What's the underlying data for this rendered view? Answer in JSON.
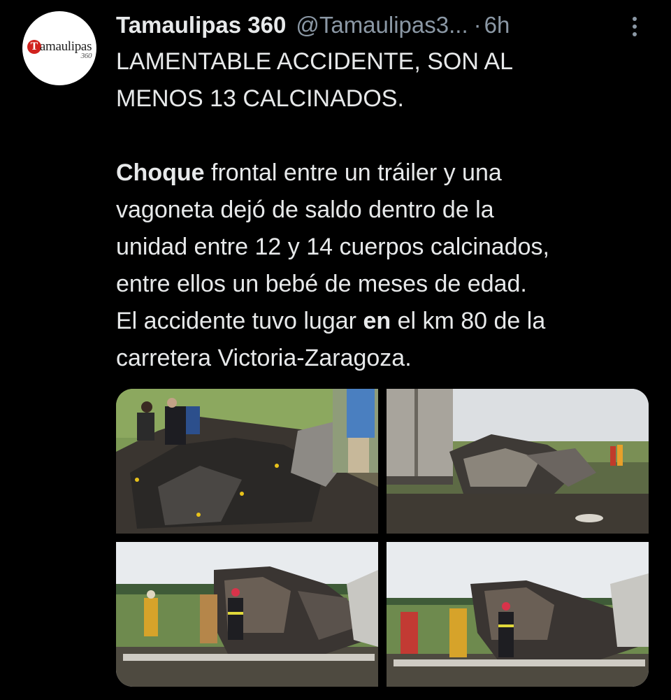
{
  "author": {
    "name": "Tamaulipas 360",
    "handle": "@Tamaulipas3...",
    "separator": "·",
    "time": "6h",
    "avatar_logo_text": "Tamaulipas",
    "avatar_logo_number": "360"
  },
  "tweet": {
    "headline_line1": "LAMENTABLE ACCIDENTE, SON AL",
    "headline_line2": "MENOS 13 CALCINADOS.",
    "p1_bold": "Choque",
    "p1_rest_1": " frontal entre un tráiler y una",
    "line2": "vagoneta dejó de saldo dentro de la",
    "line3": "unidad entre 12 y 14 cuerpos calcinados,",
    "line4": "entre ellos un bebé de meses de edad.",
    "line5_a": "El accidente tuvo lugar ",
    "line5_bold": "en",
    "line5_b": " el km 80 de la",
    "line6": "carretera Victoria-Zaragoza."
  },
  "media": {
    "photos": [
      {
        "name": "photo-burned-wreck-with-investigators"
      },
      {
        "name": "photo-trailer-and-debris-field"
      },
      {
        "name": "photo-firefighters-at-burned-van"
      },
      {
        "name": "photo-firefighters-at-burned-van-closeup"
      }
    ]
  },
  "icons": {
    "more": "more-vertical-icon"
  },
  "colors": {
    "background": "#000000",
    "text": "#e7e9ea",
    "secondary": "#8b98a5",
    "logo_red": "#d1221e"
  }
}
